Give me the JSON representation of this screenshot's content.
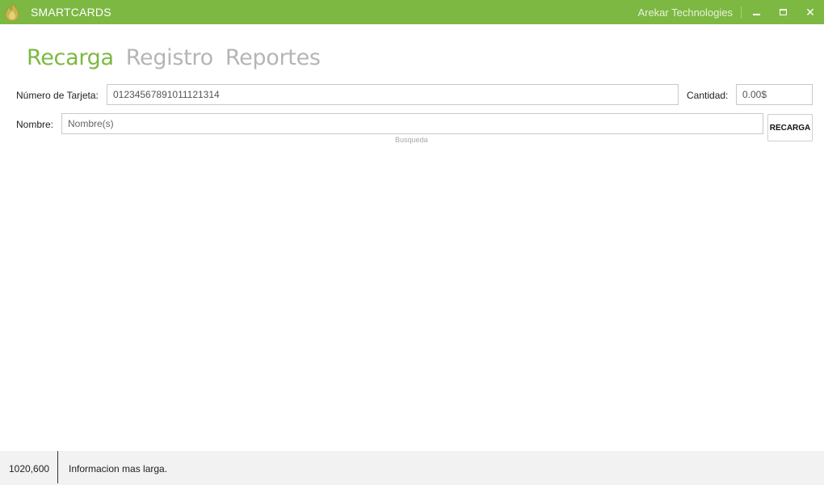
{
  "window": {
    "title": "SMARTCARDS",
    "company": "Arekar Technologies",
    "accent_color": "#7db843",
    "controls": {
      "minimize": "minimize-icon",
      "maximize": "maximize-icon",
      "close": "close-icon"
    }
  },
  "tabs": [
    {
      "label": "Recarga",
      "active": true
    },
    {
      "label": "Registro",
      "active": false
    },
    {
      "label": "Reportes",
      "active": false
    }
  ],
  "form": {
    "card_label": "Número de Tarjeta:",
    "card_value": "01234567891011121314",
    "quantity_label": "Cantidad:",
    "quantity_value": "0.00$",
    "name_label": "Nombre:",
    "name_placeholder": "Nombre(s)",
    "name_value": "",
    "search_hint": "Busqueda",
    "recharge_button": "RECARGA"
  },
  "status": {
    "size": "1020,600",
    "message": "Informacion mas larga."
  }
}
